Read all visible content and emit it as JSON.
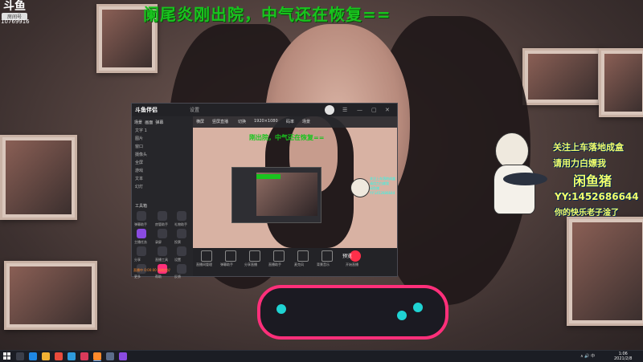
{
  "overlay": {
    "logo_glyph": "斗鱼",
    "logo_sub": "房间号",
    "room_id": "10769916",
    "title": "阑尾炎刚出院，中气还在恢复=="
  },
  "obs": {
    "app_name": "斗鱼伴侣",
    "version_badge": "设置",
    "sidebar_tabs": [
      "场景",
      "画面",
      "弹幕"
    ],
    "sources": [
      "文字 1",
      "图片",
      "窗口",
      "摄像头",
      "全屏",
      "游戏",
      "文本",
      "幻灯"
    ],
    "tools_title": "工具箱",
    "tools": [
      {
        "label": "弹幕助手"
      },
      {
        "label": "房管助手"
      },
      {
        "label": "礼物助手"
      },
      {
        "label": "主播任务"
      },
      {
        "label": "录屏"
      },
      {
        "label": "投票"
      },
      {
        "label": "分享"
      },
      {
        "label": "直播工具"
      },
      {
        "label": "设置"
      },
      {
        "label": "更多"
      },
      {
        "label": "帮助"
      },
      {
        "label": "反馈"
      }
    ],
    "preview_toolbar": [
      "横屏",
      "竖屏直播",
      "切换",
      "1920×1080",
      "码率",
      "场景"
    ],
    "subtitle_preview": "刚出院，中气还在恢复==",
    "bottom_tools": [
      {
        "label": "直播间管理"
      },
      {
        "label": "弹幕助手"
      },
      {
        "label": "分享直播"
      },
      {
        "label": "直播助手"
      },
      {
        "label": "麦克风"
      },
      {
        "label": "背景音乐"
      },
      {
        "label": "开始直播"
      }
    ],
    "status_text": "直播中 0:00:00 网络良好",
    "preview_label": "预览"
  },
  "promo": {
    "line1": "关注上车落地成盒",
    "line2": "请用力白嫖我",
    "name": "闲鱼猪",
    "yy": "YY:1452686644",
    "line5": "你的快乐老子淦了",
    "nested_lines": [
      "关注上车落地成盒",
      "请用力白嫖我",
      "闲鱼猪",
      "YY:1452686644"
    ]
  },
  "taskbar": {
    "apps": [
      {
        "name": "search",
        "color": "#3b3f4a"
      },
      {
        "name": "browser",
        "color": "#1e88e5"
      },
      {
        "name": "explorer",
        "color": "#f2b233"
      },
      {
        "name": "chrome",
        "color": "#e84b3c"
      },
      {
        "name": "store",
        "color": "#2e9bdc"
      },
      {
        "name": "music",
        "color": "#d83a5a"
      },
      {
        "name": "obs",
        "color": "#ff8a2b"
      },
      {
        "name": "steam",
        "color": "#5b6c8a"
      },
      {
        "name": "game",
        "color": "#8a4be0"
      }
    ],
    "tray_text": "∧ 🔊 中",
    "time": "1:06",
    "date": "2021/2/8"
  }
}
